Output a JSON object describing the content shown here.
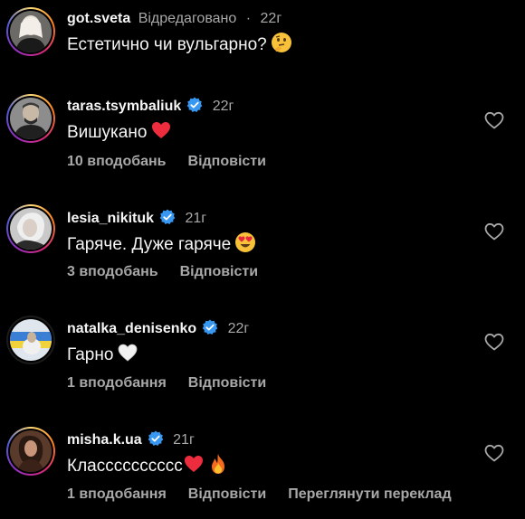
{
  "comments": [
    {
      "username": "got.sveta",
      "edited_label": "Відредаговано",
      "separator": "·",
      "time": "22г",
      "text": "Естетично чи вульгарно?",
      "emoji": "thinking-face"
    },
    {
      "username": "taras.tsymbaliuk",
      "time": "22г",
      "text": "Вишукано",
      "emoji": "red-heart",
      "likes": "10 вподобань",
      "reply": "Відповісти"
    },
    {
      "username": "lesia_nikituk",
      "time": "21г",
      "text": "Гаряче. Дуже гаряче",
      "emoji": "heart-eyes",
      "likes": "3 вподобань",
      "reply": "Відповісти"
    },
    {
      "username": "natalka_denisenko",
      "time": "22г",
      "text": "Гарно",
      "emoji": "white-heart",
      "likes": "1 вподобання",
      "reply": "Відповісти"
    },
    {
      "username": "misha.k.ua",
      "time": "21г",
      "text": "Класссссссссс",
      "emoji": "red-heart + fire",
      "likes": "1 вподобання",
      "reply": "Відповісти",
      "translate": "Переглянути переклад"
    }
  ],
  "colors": {
    "background": "#000000",
    "text": "#f5f5f5",
    "secondary": "#a8a8a8",
    "verified": "#3897f0",
    "heart": "#ed2d3d"
  }
}
